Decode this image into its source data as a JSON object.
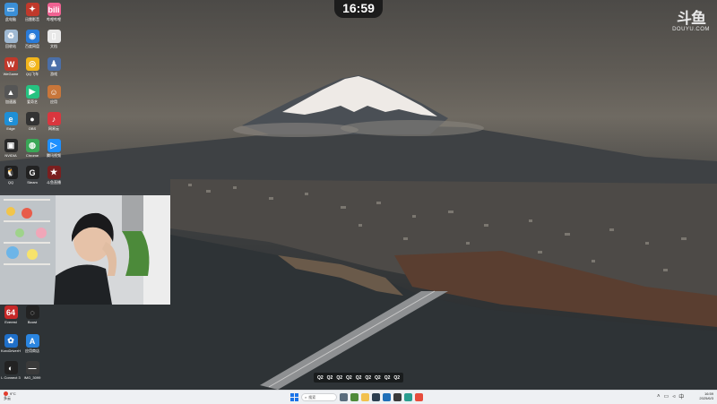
{
  "overlay": {
    "time": "16:59",
    "watermark_logo": "斗鱼",
    "watermark_text": "DOUYU.COM",
    "caption_items": [
      "Q2",
      "Q2",
      "Q2",
      "Q2",
      "Q2",
      "Q2",
      "Q2",
      "Q2",
      "Q2"
    ]
  },
  "desktop_icons": [
    {
      "name": "此电脑",
      "color": "#3b8fd6",
      "glyph": "▭"
    },
    {
      "name": "迅雷影音",
      "color": "#c0392b",
      "glyph": "✦"
    },
    {
      "name": "哔哩哔哩",
      "color": "#f06292",
      "glyph": "bili"
    },
    {
      "name": "回收站",
      "color": "#9fb9d3",
      "glyph": "♻"
    },
    {
      "name": "百度网盘",
      "color": "#2a7bd8",
      "glyph": "◉"
    },
    {
      "name": "文档",
      "color": "#e8e8e8",
      "glyph": "▯"
    },
    {
      "name": "WeGame",
      "color": "#c0392b",
      "glyph": "W"
    },
    {
      "name": "QQ飞车",
      "color": "#f2b51b",
      "glyph": "◎"
    },
    {
      "name": "游戏",
      "color": "#4b6fa8",
      "glyph": "♟"
    },
    {
      "name": "加速器",
      "color": "#555",
      "glyph": "▲"
    },
    {
      "name": "爱奇艺",
      "color": "#26c281",
      "glyph": "▶"
    },
    {
      "name": "应用",
      "color": "#c8763a",
      "glyph": "☺"
    },
    {
      "name": "Edge",
      "color": "#1f8fd6",
      "glyph": "e"
    },
    {
      "name": "OBS",
      "color": "#333",
      "glyph": "●"
    },
    {
      "name": "网易云",
      "color": "#d9363e",
      "glyph": "♪"
    },
    {
      "name": "NVIDIA",
      "color": "#2a2a2a",
      "glyph": "▣"
    },
    {
      "name": "Chrome",
      "color": "#3aa757",
      "glyph": "◍"
    },
    {
      "name": "腾讯视频",
      "color": "#1e90ff",
      "glyph": "▷"
    },
    {
      "name": "QQ",
      "color": "#1f1f1f",
      "glyph": "🐧"
    },
    {
      "name": "Steam",
      "color": "#222",
      "glyph": "G"
    },
    {
      "name": "斗鱼直播",
      "color": "#7a1f1f",
      "glyph": "★"
    },
    {
      "name": "Everest",
      "color": "#c62828",
      "glyph": "64"
    },
    {
      "name": "Boost",
      "color": "#222",
      "glyph": "◌"
    },
    {
      "name": "KoroDriverHub",
      "color": "#1f6fc8",
      "glyph": "✿"
    },
    {
      "name": "应用商店",
      "color": "#2a85e0",
      "glyph": "A"
    },
    {
      "name": "L Connect 3",
      "color": "#222",
      "glyph": "◐"
    },
    {
      "name": "IMG_3099",
      "color": "#3a3a3a",
      "glyph": "—"
    }
  ],
  "taskbar": {
    "weather_temp": "9°C",
    "weather_desc": "多云",
    "search_placeholder": "搜索",
    "time": "16:59",
    "date": "2025/6/3"
  }
}
